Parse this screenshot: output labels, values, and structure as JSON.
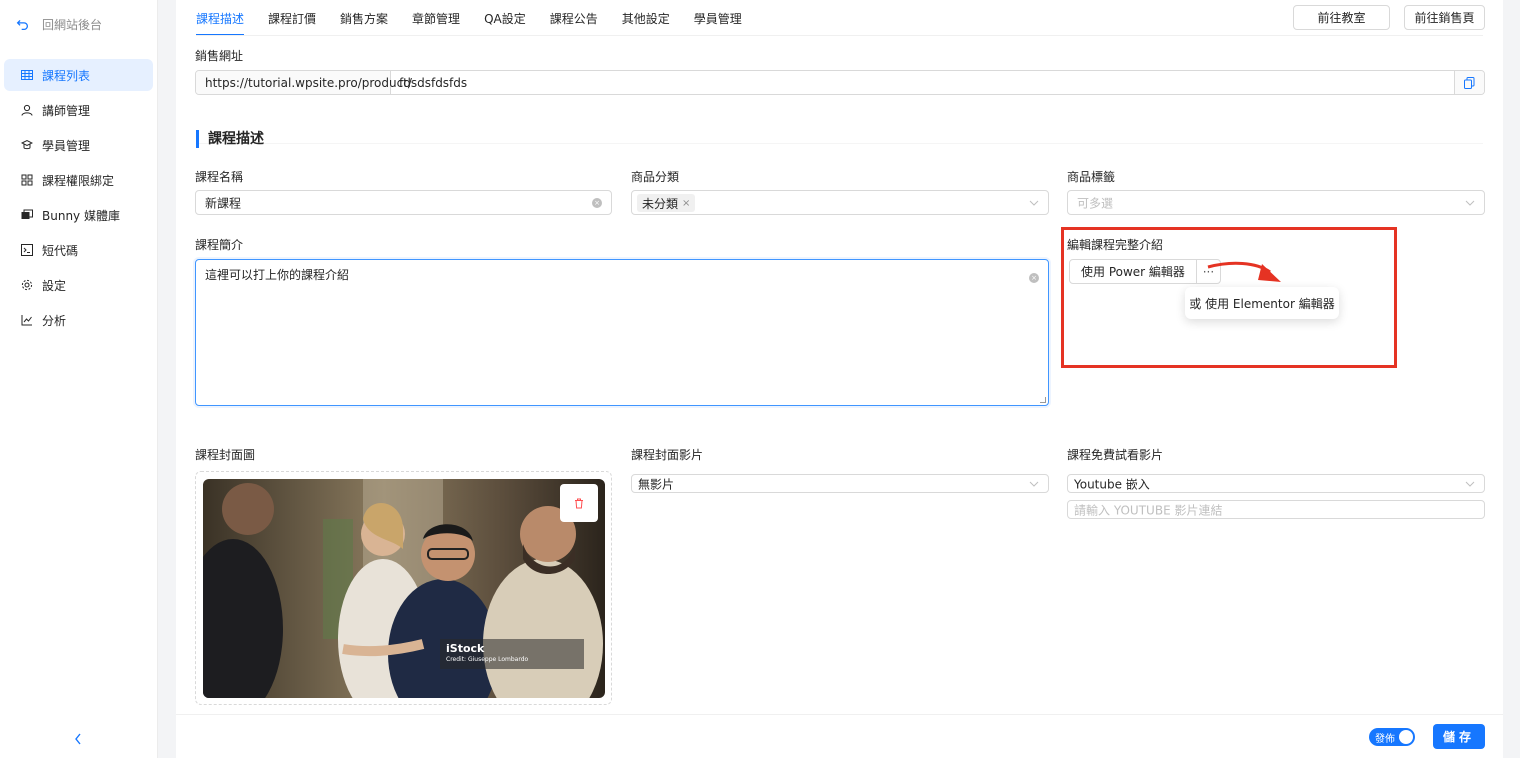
{
  "sidebar": {
    "back_label": "回網站後台",
    "items": [
      {
        "label": "課程列表",
        "icon": "table-icon",
        "active": true
      },
      {
        "label": "講師管理",
        "icon": "user-icon",
        "active": false
      },
      {
        "label": "學員管理",
        "icon": "students-icon",
        "active": false
      },
      {
        "label": "課程權限綁定",
        "icon": "grid-icon",
        "active": false
      },
      {
        "label": "Bunny 媒體庫",
        "icon": "media-icon",
        "active": false
      },
      {
        "label": "短代碼",
        "icon": "code-icon",
        "active": false
      },
      {
        "label": "設定",
        "icon": "gear-icon",
        "active": false
      },
      {
        "label": "分析",
        "icon": "chart-icon",
        "active": false
      }
    ]
  },
  "tabs": [
    "課程描述",
    "課程訂價",
    "銷售方案",
    "章節管理",
    "QA設定",
    "課程公告",
    "其他設定",
    "學員管理"
  ],
  "header_buttons": {
    "classroom": "前往教室",
    "sales_page": "前往銷售頁"
  },
  "sales_url": {
    "label": "銷售網址",
    "prefix": "https://tutorial.wpsite.pro/product/",
    "slug": "fdsdsfdsfds"
  },
  "section_title": "課程描述",
  "course_name": {
    "label": "課程名稱",
    "value": "新課程"
  },
  "category": {
    "label": "商品分類",
    "tag": "未分類"
  },
  "product_tags": {
    "label": "商品標籤",
    "placeholder": "可多選"
  },
  "summary": {
    "label": "課程簡介",
    "value": "這裡可以打上你的課程介紹"
  },
  "full_intro": {
    "label": "編輯課程完整介紹",
    "power_editor": "使用 Power 編輯器",
    "more": "···",
    "elementor_option": "或 使用 Elementor 編輯器"
  },
  "cover_image": {
    "label": "課程封面圖",
    "watermark_brand": "iStock",
    "watermark_credit": "Credit: Giuseppe Lombardo"
  },
  "cover_video": {
    "label": "課程封面影片",
    "value": "無影片"
  },
  "trial_video": {
    "label": "課程免費試看影片",
    "value": "Youtube 嵌入",
    "url_placeholder": "請輸入 YOUTUBE 影片連結"
  },
  "footer": {
    "publish_label": "發佈",
    "publish_on": true,
    "save_label": "儲存"
  },
  "colors": {
    "primary": "#1677ff",
    "highlight": "#e53323"
  }
}
